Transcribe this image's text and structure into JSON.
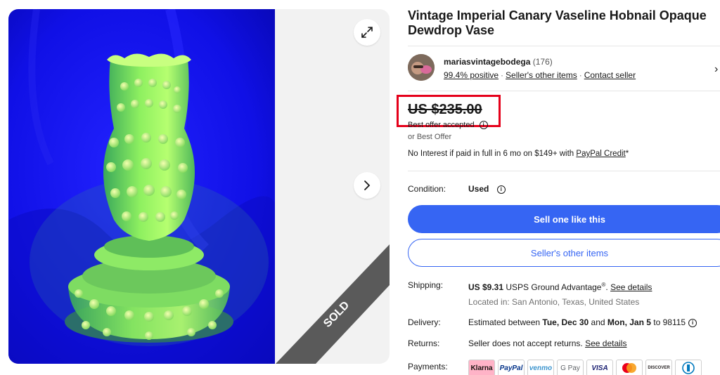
{
  "listing": {
    "title": "Vintage Imperial Canary Vaseline Hobnail Opaque Dewdrop Vase",
    "sold_label": "SOLD"
  },
  "seller": {
    "name": "mariasvintagebodega",
    "feedback_count": "(176)",
    "positive": "99.4% positive",
    "other_items_link": "Seller's other items",
    "contact_link": "Contact seller",
    "separator": "·"
  },
  "price": {
    "amount": "US $235.00",
    "offer_accepted": "Best offer accepted",
    "or_best_offer": "or Best Offer",
    "paypal_prefix": "No Interest if paid in full in 6 mo on $149+ with ",
    "paypal_link": "PayPal Credit",
    "paypal_suffix": "*"
  },
  "condition": {
    "label": "Condition:",
    "value": "Used"
  },
  "buttons": {
    "sell_one": "Sell one like this",
    "other_items": "Seller's other items"
  },
  "shipping": {
    "label": "Shipping:",
    "price": "US $9.31",
    "service": " USPS Ground Advantage",
    "registered": "®",
    "period": ". ",
    "details_link": "See details",
    "location": "Located in: San Antonio, Texas, United States"
  },
  "delivery": {
    "label": "Delivery:",
    "prefix": "Estimated between ",
    "start": "Tue, Dec 30",
    "and": " and ",
    "end": "Mon, Jan 5",
    "suffix": " to 98115"
  },
  "returns": {
    "label": "Returns:",
    "text": "Seller does not accept returns. ",
    "details_link": "See details"
  },
  "payments": {
    "label": "Payments:",
    "methods": [
      "Klarna",
      "PayPal",
      "venmo",
      "G Pay",
      "VISA",
      "Mastercard",
      "DISCOVER",
      "Diners Club"
    ]
  },
  "colors": {
    "accent": "#3665f3",
    "highlight": "#e5001a",
    "sold_ribbon": "#5a5a5a",
    "photo_bg": "#1414e0",
    "vase": "#9ef25a"
  }
}
